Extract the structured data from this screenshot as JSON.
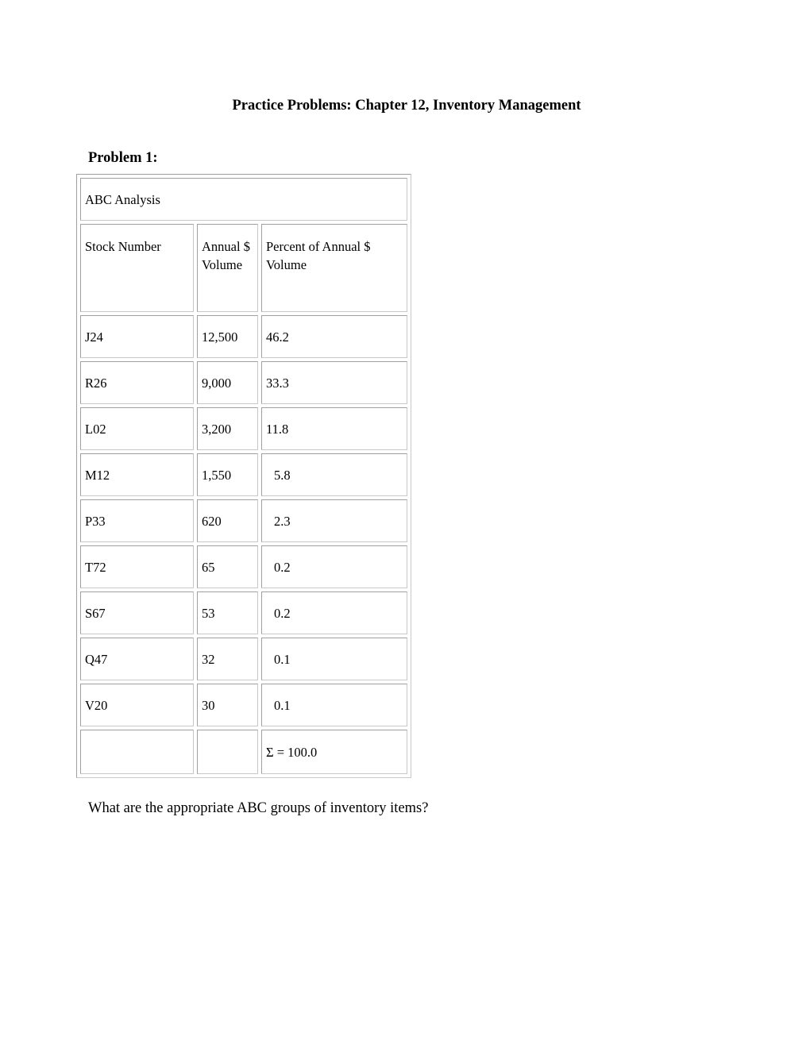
{
  "document": {
    "title": "Practice Problems: Chapter 12, Inventory Management",
    "problem_heading": "Problem 1:",
    "question": "What are the appropriate ABC groups of inventory items?"
  },
  "table": {
    "caption": "ABC Analysis",
    "headers": [
      "Stock Number",
      "Annual $ Volume",
      "Percent of Annual $ Volume"
    ],
    "rows": [
      {
        "stock_number": "J24",
        "annual_volume": "12,500",
        "percent": "46.2"
      },
      {
        "stock_number": "R26",
        "annual_volume": "9,000",
        "percent": "33.3"
      },
      {
        "stock_number": "L02",
        "annual_volume": "3,200",
        "percent": "11.8"
      },
      {
        "stock_number": "M12",
        "annual_volume": "1,550",
        "percent": "5.8"
      },
      {
        "stock_number": "P33",
        "annual_volume": "620",
        "percent": "2.3"
      },
      {
        "stock_number": "T72",
        "annual_volume": "65",
        "percent": "0.2"
      },
      {
        "stock_number": "S67",
        "annual_volume": "53",
        "percent": "0.2"
      },
      {
        "stock_number": "Q47",
        "annual_volume": "32",
        "percent": "0.1"
      },
      {
        "stock_number": "V20",
        "annual_volume": "30",
        "percent": "0.1"
      }
    ],
    "total_row": {
      "stock_number": "",
      "annual_volume": "",
      "percent": "Σ = 100.0"
    }
  }
}
